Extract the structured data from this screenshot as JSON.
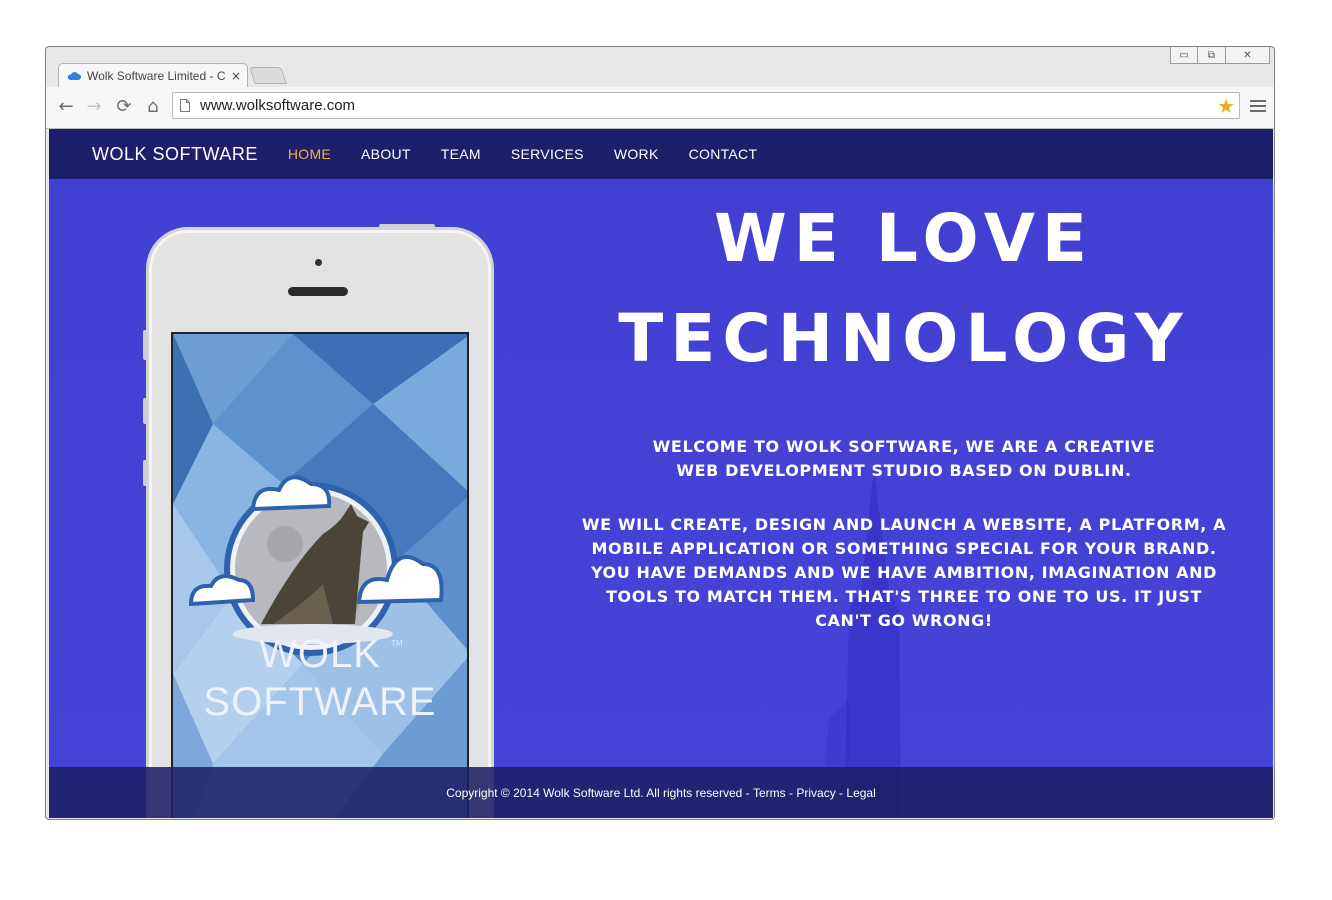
{
  "browser": {
    "tab_title": "Wolk Software Limited - C",
    "tab_close": "×",
    "url": "www.wolksoftware.com",
    "controls": {
      "minimize": "▭",
      "restore": "⧉",
      "close": "✕"
    },
    "back_icon": "←",
    "forward_icon": "→",
    "reload_icon": "⟳",
    "home_icon": "⌂",
    "star_icon": "★"
  },
  "site": {
    "brand": "WOLK SOFTWARE",
    "nav": [
      "HOME",
      "ABOUT",
      "TEAM",
      "SERVICES",
      "WORK",
      "CONTACT"
    ],
    "active_nav": "HOME",
    "hero_title_line1": "WE LOVE",
    "hero_title_line2": "TECHNOLOGY",
    "intro": "WELCOME TO WOLK SOFTWARE, WE ARE A CREATIVE WEB DEVELOPMENT STUDIO BASED ON DUBLIN.",
    "body": "WE WILL CREATE, DESIGN AND LAUNCH A WEBSITE, A PLATFORM, A MOBILE APPLICATION OR SOMETHING SPECIAL FOR YOUR BRAND. YOU HAVE DEMANDS AND WE HAVE AMBITION, IMAGINATION AND TOOLS TO MATCH THEM. THAT'S THREE TO ONE TO US. IT JUST CAN'T GO WRONG!",
    "phone_logo_line1": "WOLK",
    "phone_logo_line2": "SOFTWARE",
    "phone_logo_tm": "TM",
    "footer": {
      "copyright": "Copyright © 2014 Wolk Software Ltd. All rights reserved -",
      "terms": "Terms",
      "privacy": "Privacy",
      "legal": "Legal",
      "sep": "-"
    }
  },
  "colors": {
    "nav_bg": "#1e1f6b",
    "hero_bg": "#4240d2",
    "active_nav": "#f0b53e",
    "star": "#e8b21c"
  }
}
